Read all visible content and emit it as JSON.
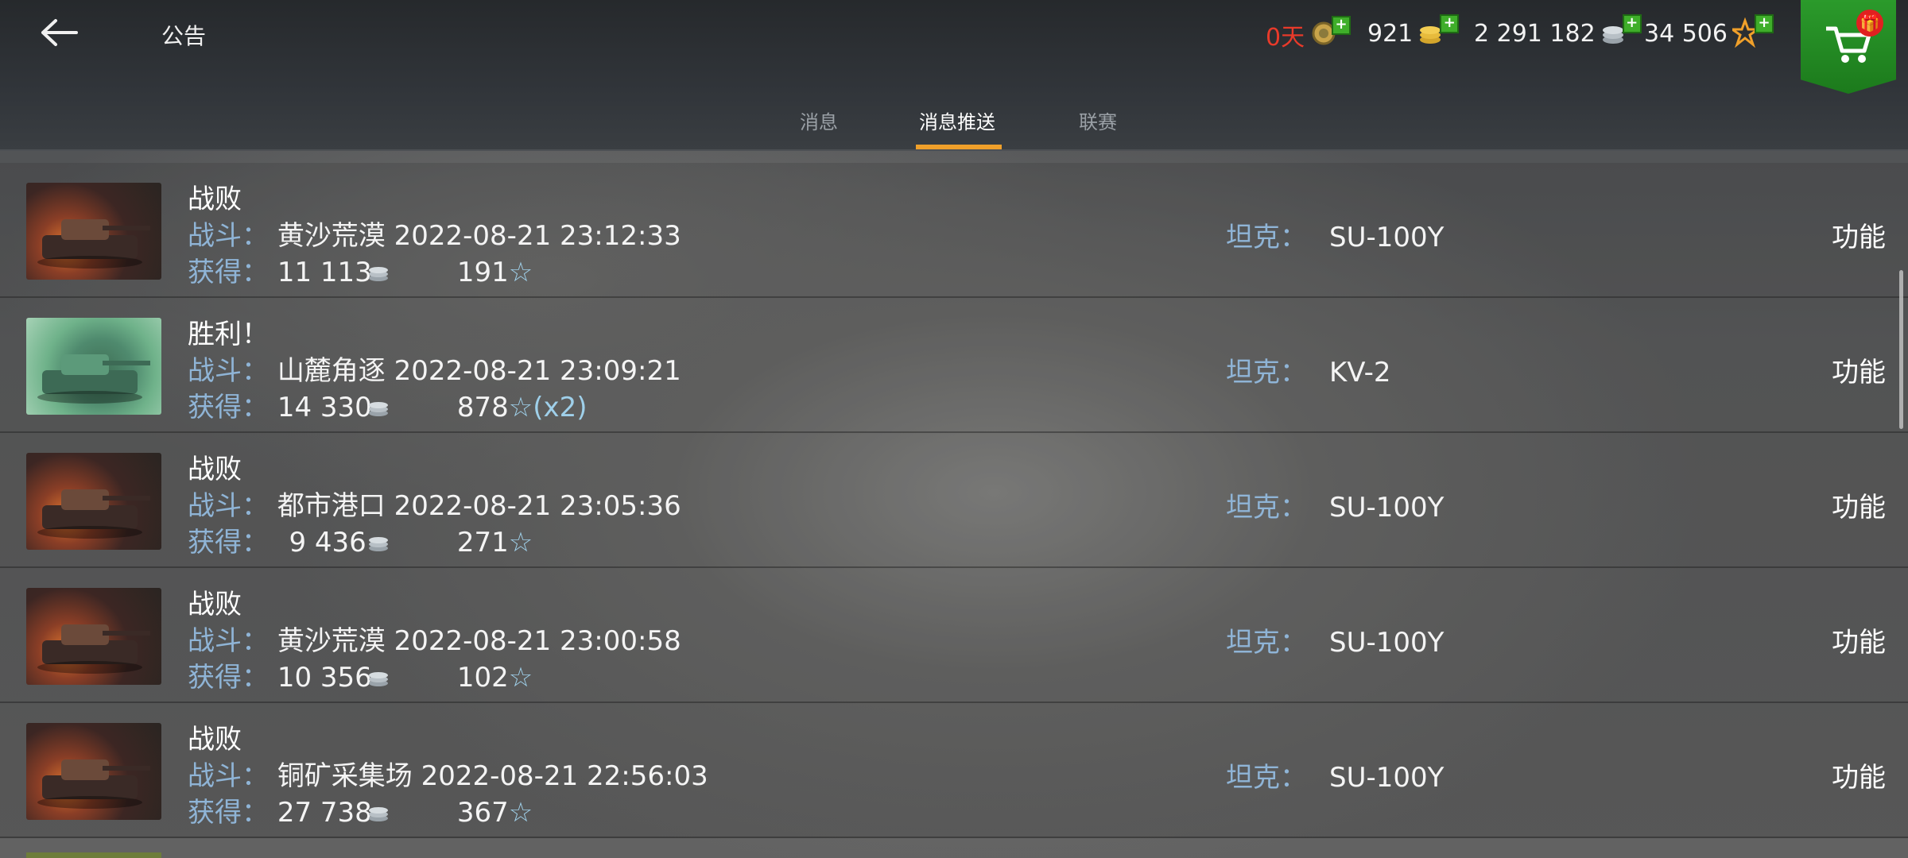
{
  "header": {
    "title": "公告",
    "resources": {
      "premium_days": "0天",
      "gold": "921",
      "credits": "2 291 182",
      "free_xp": "34 506"
    }
  },
  "tabs": [
    {
      "label": "消息"
    },
    {
      "label": "消息推送"
    },
    {
      "label": "联赛"
    }
  ],
  "labels": {
    "battle": "战斗：",
    "earned": "获得：",
    "tank": "坦克：",
    "function": "功能"
  },
  "messages": [
    {
      "result": "战败",
      "battle": "黄沙荒漠 2022-08-21 23:12:33",
      "credits": "11 113",
      "xp": "191",
      "xp_mult": "",
      "tank": "SU-100Y",
      "image": "defeat"
    },
    {
      "result": "胜利！",
      "battle": "山麓角逐 2022-08-21 23:09:21",
      "credits": "14 330",
      "xp": "878",
      "xp_mult": "(x2)",
      "tank": "KV-2",
      "image": "victory"
    },
    {
      "result": "战败",
      "battle": "都市港口 2022-08-21 23:05:36",
      "credits": "9 436",
      "xp": "271",
      "xp_mult": "",
      "tank": "SU-100Y",
      "image": "defeat"
    },
    {
      "result": "战败",
      "battle": "黄沙荒漠 2022-08-21 23:00:58",
      "credits": "10 356",
      "xp": "102",
      "xp_mult": "",
      "tank": "SU-100Y",
      "image": "defeat"
    },
    {
      "result": "战败",
      "battle": "铜矿采集场 2022-08-21 22:56:03",
      "credits": "27 738",
      "xp": "367",
      "xp_mult": "",
      "tank": "SU-100Y",
      "image": "defeat"
    }
  ],
  "colors": {
    "accent": "#f0a02a",
    "premium_text": "#e83a2a",
    "label_blue": "#8fb4d6",
    "cart_green": "#2b9a2b"
  }
}
